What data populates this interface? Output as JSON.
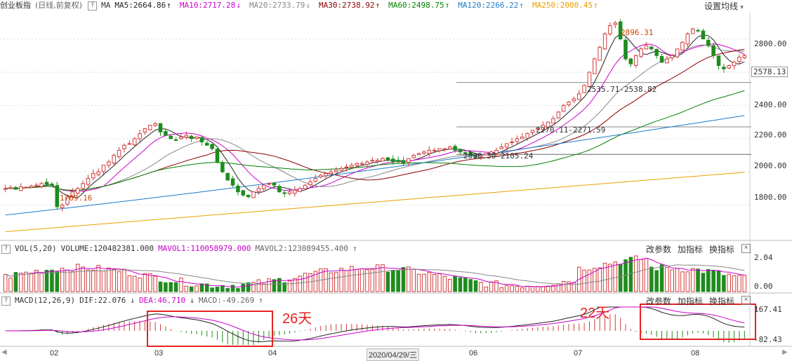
{
  "header": {
    "title": "创业板指",
    "mode": "(日线,前复权)",
    "help": "?",
    "ma_label": "MA",
    "ma": [
      {
        "label": "MA5:2664.86",
        "color": "#222222",
        "arrow": "↑"
      },
      {
        "label": "MA10:2717.28",
        "color": "#cc00cc",
        "arrow": "↓"
      },
      {
        "label": "MA20:2733.79",
        "color": "#888888",
        "arrow": "↓"
      },
      {
        "label": "MA30:2738.92",
        "color": "#8b0000",
        "arrow": "↑"
      },
      {
        "label": "MA60:2498.75",
        "color": "#008000",
        "arrow": "↑"
      },
      {
        "label": "MA120:2266.22",
        "color": "#1e7bc8",
        "arrow": "↑"
      },
      {
        "label": "MA250:2000.45",
        "color": "#e8a000",
        "arrow": "↑"
      }
    ],
    "settings": "设置均线",
    "settings_caret": "▾"
  },
  "vol_header": {
    "help": "?",
    "name": "VOL(5,20)",
    "volume": "VOLUME:120482381.000",
    "mavol1": "MAVOL1:110058979.000",
    "mavol2": "MAVOL2:123089455.400",
    "arrow": "↑",
    "btn_params": "改参数",
    "btn_add": "加指标",
    "btn_switch": "换指标",
    "close": "×"
  },
  "macd_header": {
    "help": "?",
    "name": "MACD(12,26,9)",
    "dif": "DIF:22.076",
    "dif_arrow": "↓",
    "dea": "DEA:46.710",
    "dea_arrow": "↓",
    "macd": "MACD:-49.269",
    "macd_arrow": "↑",
    "btn_params": "改参数",
    "btn_add": "加指标",
    "btn_switch": "换指标",
    "close": "×"
  },
  "annotations": {
    "high": "2896.31",
    "low": "1769.16",
    "line1": "2535.71-2538.82",
    "line2": "2270.11-2271.59",
    "line3": "2090.30-2105.24",
    "box1_label": "26天",
    "box2_label": "22天",
    "date_cursor": "2020/04/29/三"
  },
  "chart_data": {
    "type": "candlestick",
    "price_axis": {
      "ticks": [
        "2800.00",
        "2600.00",
        "2400.00",
        "2200.00",
        "2000.00",
        "1800.00"
      ],
      "current": "2578.13",
      "range": [
        1600,
        2950
      ]
    },
    "volume_axis": {
      "ticks": [
        "2.04",
        "0.00"
      ]
    },
    "macd_axis": {
      "ticks": [
        "167.41",
        "-82.43"
      ]
    },
    "x_labels": [
      "02",
      "03",
      "04",
      "06",
      "07",
      "08"
    ],
    "close": [
      1900,
      1905,
      1895,
      1910,
      1908,
      1915,
      1920,
      1930,
      1925,
      1920,
      1790,
      1800,
      1850,
      1880,
      1900,
      1930,
      1960,
      1990,
      2000,
      2040,
      2060,
      2100,
      2130,
      2160,
      2170,
      2200,
      2230,
      2260,
      2280,
      2290,
      2240,
      2220,
      2200,
      2190,
      2210,
      2220,
      2200,
      2210,
      2180,
      2160,
      2140,
      2060,
      2000,
      1950,
      1920,
      1880,
      1860,
      1850,
      1880,
      1900,
      1920,
      1930,
      1920,
      1880,
      1870,
      1880,
      1890,
      1900,
      1920,
      1940,
      1960,
      1980,
      1990,
      2000,
      2010,
      2020,
      2030,
      2040,
      2050,
      2050,
      2060,
      2070,
      2070,
      2080,
      2070,
      2060,
      2060,
      2050,
      2080,
      2100,
      2110,
      2120,
      2130,
      2130,
      2140,
      2140,
      2150,
      2130,
      2120,
      2110,
      2100,
      2090,
      2100,
      2110,
      2120,
      2130,
      2150,
      2170,
      2180,
      2200,
      2210,
      2230,
      2250,
      2260,
      2280,
      2300,
      2320,
      2360,
      2400,
      2420,
      2440,
      2470,
      2520,
      2600,
      2680,
      2750,
      2830,
      2880,
      2896,
      2800,
      2680,
      2650,
      2700,
      2740,
      2760,
      2740,
      2700,
      2660,
      2680,
      2700,
      2740,
      2780,
      2830,
      2860,
      2850,
      2800,
      2760,
      2700,
      2640,
      2620,
      2640,
      2660,
      2690,
      2700
    ]
  }
}
